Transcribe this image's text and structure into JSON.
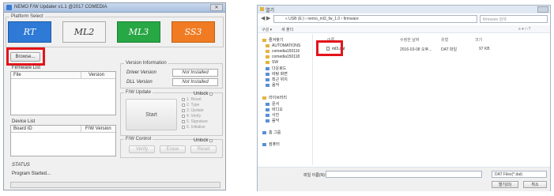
{
  "updater": {
    "title": "NEMO F/W Updater v1.1 @2017 COMEDIA",
    "close_label": "✕",
    "platform_select_label": "Platform Select",
    "platforms": [
      {
        "label": "RT",
        "color": "#2e7ad6"
      },
      {
        "label": "ML2",
        "color": "#f3f3f3"
      },
      {
        "label": "ML3",
        "color": "#28a745"
      },
      {
        "label": "SS3",
        "color": "#f07b22"
      }
    ],
    "browse_label": "Browse...",
    "firmware_list_label": "Firmware List",
    "firmware_columns": [
      "File",
      "Version"
    ],
    "version_info": {
      "label": "Version Information",
      "driver_label": "Driver Version",
      "driver_value": "Not Installed",
      "dll_label": "DLL Version",
      "dll_value": "Not Installed"
    },
    "fw_update": {
      "label": "F/W Update",
      "unlock_label": "Unlock",
      "start_label": "Start",
      "steps": [
        "1. Reset",
        "2. Type",
        "3. Update",
        "4. Verify",
        "5. Signature",
        "6. Initialize"
      ]
    },
    "device_list_label": "Device List",
    "device_columns": [
      "Board ID",
      "F/W Version"
    ],
    "fw_control": {
      "label": "F/W Control",
      "unlock_label": "Unlock",
      "buttons": [
        "Verify",
        "Erase",
        "Reset"
      ]
    },
    "status_label": "STATUS",
    "status_text": "Program Started..."
  },
  "highlight_color": "#e3141b",
  "open_dialog": {
    "title": "열기",
    "breadcrumb": "« USB (E:) › nemo_ml3_fw_1.0 › firmware",
    "search_placeholder": "firmware 검색",
    "toolbar": {
      "organize": "구성 ▾",
      "new_folder": "새 폴더"
    },
    "nav_items": [
      {
        "label": "즐겨찾기",
        "icon_color": "#e3b341"
      },
      {
        "label": "AUTOMATIONS",
        "icon_color": "#e3b341"
      },
      {
        "label": "comedia150116",
        "icon_color": "#e3b341"
      },
      {
        "label": "comedia150118",
        "icon_color": "#e3b341"
      },
      {
        "label": "SW",
        "icon_color": "#e3b341"
      },
      {
        "label": "다운로드",
        "icon_color": "#5a8fd6"
      },
      {
        "label": "바탕 화면",
        "icon_color": "#5a8fd6"
      },
      {
        "label": "최근 위치",
        "icon_color": "#5a8fd6"
      },
      {
        "label": "음악",
        "icon_color": "#5a8fd6"
      },
      {
        "label": "라이브러리",
        "icon_color": "#e3b341"
      },
      {
        "label": "문서",
        "icon_color": "#5a8fd6"
      },
      {
        "label": "비디오",
        "icon_color": "#5a8fd6"
      },
      {
        "label": "사진",
        "icon_color": "#5a8fd6"
      },
      {
        "label": "음악",
        "icon_color": "#5a8fd6"
      },
      {
        "label": "홈 그룹",
        "icon_color": "#5a8fd6"
      },
      {
        "label": "컴퓨터",
        "icon_color": "#5a8fd6"
      }
    ],
    "columns": [
      "이름",
      "수정한 날짜",
      "유형",
      "크기"
    ],
    "files": [
      {
        "name": "ml3.dat",
        "date": "2016-03-08 오후...",
        "type": "DAT 파일",
        "size": "97 KB"
      }
    ],
    "filename_label": "파일 이름(N):",
    "filetype_value": "DAT Files(*.dat)",
    "open_label": "열기(O)",
    "cancel_label": "취소"
  }
}
